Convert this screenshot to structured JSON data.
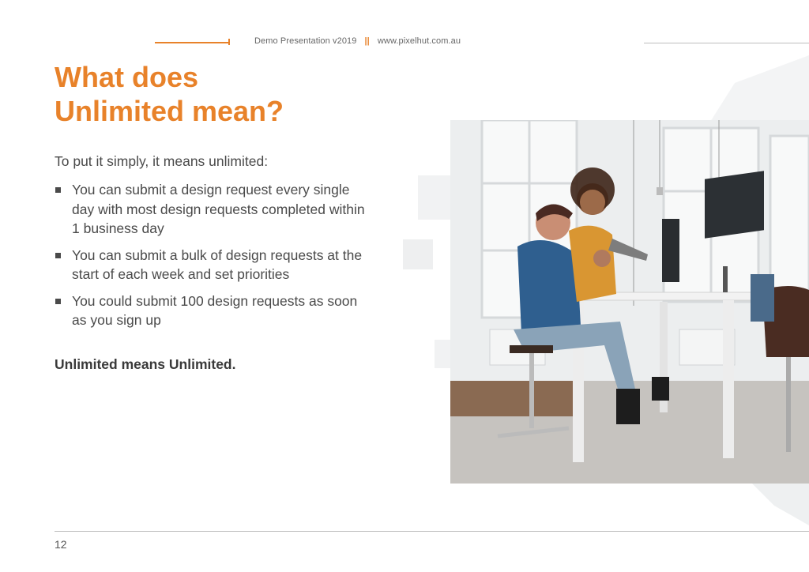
{
  "header": {
    "presentation": "Demo Presentation  v2019",
    "separator": "||",
    "website": "www.pixelhut.com.au"
  },
  "title": {
    "line1": "What does",
    "line2": "Unlimited mean?"
  },
  "intro": "To put it simply, it means unlimited:",
  "bullets": [
    "You can submit a design request every single day with most design requests completed within 1 business day",
    "You can submit a bulk of design requests at the start of each week and set priorities",
    "You could submit 100 design requests as soon as you sign up"
  ],
  "closing": "Unlimited means Unlimited.",
  "page_number": "12",
  "colors": {
    "accent": "#e8822a",
    "text": "#4a4a4a",
    "rule": "#bdbdbd"
  },
  "image": {
    "subject": "office-team-at-computer-photo"
  }
}
